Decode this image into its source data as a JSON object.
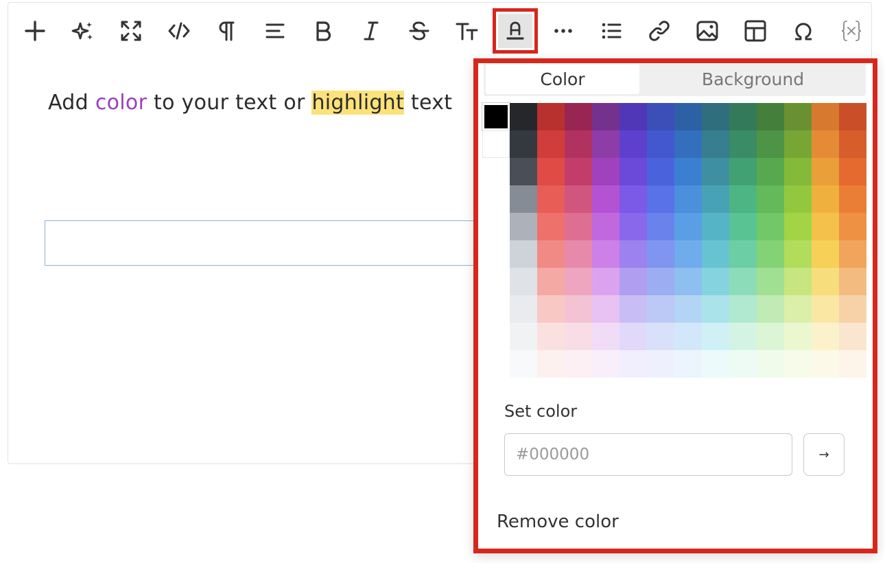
{
  "toolbar": {
    "tools": [
      {
        "name": "add-icon"
      },
      {
        "name": "ai-sparkle-icon"
      },
      {
        "name": "fullscreen-icon"
      },
      {
        "name": "code-icon"
      },
      {
        "name": "paragraph-icon"
      },
      {
        "name": "align-left-icon"
      },
      {
        "name": "bold-icon"
      },
      {
        "name": "italic-icon"
      },
      {
        "name": "strikethrough-icon"
      },
      {
        "name": "font-size-icon"
      },
      {
        "name": "text-color-icon",
        "active": true
      },
      {
        "name": "more-icon"
      },
      {
        "name": "bullet-list-icon"
      },
      {
        "name": "link-icon"
      },
      {
        "name": "image-icon"
      },
      {
        "name": "table-icon"
      },
      {
        "name": "special-char-icon"
      },
      {
        "name": "variable-icon"
      }
    ]
  },
  "content": {
    "part1": "Add ",
    "colored_word": "color",
    "part2": " to your text or ",
    "highlighted_word": "highlight",
    "part3": " text"
  },
  "colors": {
    "accent_frame": "#d7271d",
    "purple_text": "#9b3fbf",
    "highlight_bg": "#fbe27b"
  },
  "popover": {
    "tabs": [
      "Color",
      "Background"
    ],
    "selected_tab": "Color",
    "set_color_label": "Set color",
    "hex_placeholder": "#000000",
    "apply_button": "→",
    "remove_label": "Remove color",
    "selected_swatch": "#000000"
  },
  "palette": {
    "bw": [
      "#000000",
      "#ffffff"
    ],
    "grays": [
      "#25272b",
      "#343940",
      "#4a4f57",
      "#868c96",
      "#adb2ba",
      "#ced2d9",
      "#dfe2e7",
      "#e9ebee",
      "#f1f2f4",
      "#f8f9fa"
    ],
    "hue_columns": [
      [
        "#b8312f",
        "#d03d3a",
        "#e04b45",
        "#e95d57",
        "#ee716b",
        "#f08a85",
        "#f4a9a5",
        "#f8c8c5",
        "#fae1df",
        "#fdf1f0"
      ],
      [
        "#982552",
        "#b2325f",
        "#c33d6b",
        "#d0567f",
        "#de6f93",
        "#e689aa",
        "#eea6c0",
        "#f3c3d4",
        "#f8dde6",
        "#fcf0f4"
      ],
      [
        "#75318e",
        "#8d3ca8",
        "#a042bd",
        "#b452d4",
        "#c268de",
        "#cd80e8",
        "#dba3ef",
        "#e7c2f3",
        "#f1dcf7",
        "#f8effb"
      ],
      [
        "#5037b8",
        "#5e40cf",
        "#6b4ad9",
        "#7a5ae6",
        "#8968ec",
        "#9b82ee",
        "#b09ef1",
        "#c9bdf6",
        "#e0d9fa",
        "#f1eefd"
      ],
      [
        "#3c4fb8",
        "#4358cf",
        "#4a63dc",
        "#5972e7",
        "#6a83ec",
        "#7f95ef",
        "#9cadf2",
        "#bcc8f6",
        "#d9e1fa",
        "#eef1fd"
      ],
      [
        "#2d61a6",
        "#336fbd",
        "#3a7fd0",
        "#4b8fdd",
        "#5a9ee6",
        "#6eaceb",
        "#8dc0f0",
        "#b2d5f5",
        "#d3e7fa",
        "#ecf4fd"
      ],
      [
        "#2f6e7d",
        "#377e90",
        "#3e8fa2",
        "#48a2b6",
        "#55b4c6",
        "#67c3d2",
        "#85d3de",
        "#abe3eb",
        "#cff1f5",
        "#ecfafb"
      ],
      [
        "#327a5a",
        "#3a8c66",
        "#42a173",
        "#4db483",
        "#59c393",
        "#6ccea4",
        "#8ddcb9",
        "#b1e9d0",
        "#d3f4e4",
        "#edfbf4"
      ],
      [
        "#447f3c",
        "#4d9446",
        "#58a84f",
        "#64b95b",
        "#72c868",
        "#83d276",
        "#a0e093",
        "#c0ebb5",
        "#dcf5d4",
        "#f0fbec"
      ],
      [
        "#6a9131",
        "#77a635",
        "#84b93a",
        "#93c83e",
        "#a2d446",
        "#b2dc5c",
        "#c7e67f",
        "#dbefa9",
        "#ebf7cf",
        "#f6fbea"
      ],
      [
        "#d7792f",
        "#e58b35",
        "#eb9f38",
        "#f0b03e",
        "#f4c24a",
        "#f6d057",
        "#f7dd7b",
        "#f9e7a3",
        "#fbf2cb",
        "#fdf9e8"
      ],
      [
        "#c94f28",
        "#d75d2b",
        "#e46a2f",
        "#eb7e36",
        "#ef9143",
        "#f1a45b",
        "#f4bb80",
        "#f7d2a9",
        "#fae5cf",
        "#fdf4ea"
      ]
    ]
  }
}
